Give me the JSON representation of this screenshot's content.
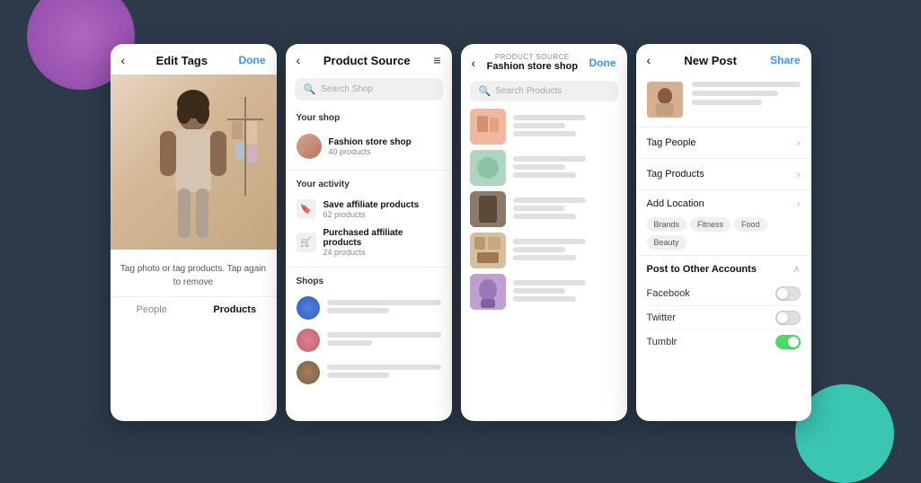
{
  "background": {
    "purple_circle": true,
    "teal_circle": true
  },
  "screen1": {
    "header": {
      "back_icon": "‹",
      "title": "Edit Tags",
      "done_label": "Done"
    },
    "caption": "Tag photo or tag products.\nTap again to remove",
    "tabs": [
      {
        "label": "People",
        "active": false
      },
      {
        "label": "Products",
        "active": true
      }
    ]
  },
  "screen2": {
    "header": {
      "back_icon": "‹",
      "title": "Product Source",
      "menu_icon": "≡"
    },
    "search_placeholder": "Search Shop",
    "your_shop_label": "Your shop",
    "shop": {
      "name": "Fashion store shop",
      "count": "40 products"
    },
    "your_activity_label": "Your activity",
    "activities": [
      {
        "icon": "🔖",
        "name": "Save affiliate products",
        "count": "62 products"
      },
      {
        "icon": "🛒",
        "name": "Purchased affiliate products",
        "count": "24 products"
      }
    ],
    "shops_label": "Shops"
  },
  "screen3": {
    "header": {
      "back_icon": "‹",
      "subtitle": "Product Source",
      "title": "Fashion store shop",
      "done_label": "Done"
    },
    "search_placeholder": "Search Products",
    "products": [
      {
        "color": "pink"
      },
      {
        "color": "green"
      },
      {
        "color": "dark"
      },
      {
        "color": "multi"
      },
      {
        "color": "purple"
      }
    ]
  },
  "screen4": {
    "header": {
      "back_icon": "‹",
      "title": "New Post",
      "share_label": "Share"
    },
    "actions": [
      {
        "label": "Tag People"
      },
      {
        "label": "Tag Products"
      }
    ],
    "add_location_label": "Add Location",
    "location_tags": [
      "Brands",
      "Fitness",
      "Food",
      "Beauty"
    ],
    "other_accounts_label": "Post to Other Accounts",
    "social_accounts": [
      {
        "label": "Facebook",
        "on": false
      },
      {
        "label": "Twitter",
        "on": false
      },
      {
        "label": "Tumblr",
        "on": false
      }
    ]
  }
}
